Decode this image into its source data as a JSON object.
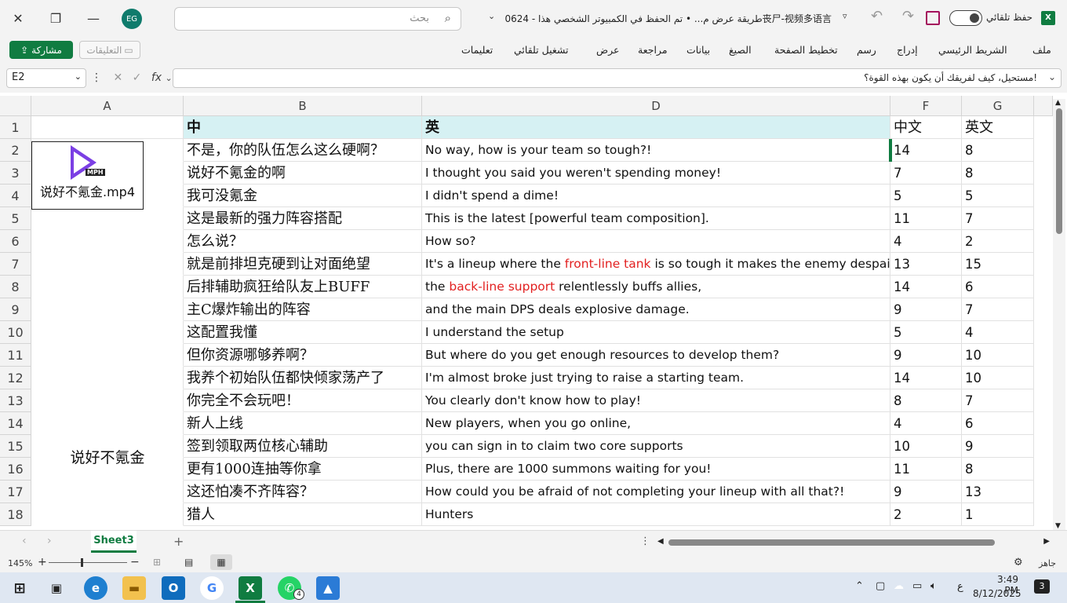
{
  "titlebar": {
    "avatar_initials": "EG",
    "search_placeholder": "بحث",
    "document_title": "طريقة عرض م... • تم الحفظ في الكمبيوتر الشخصي هذا  -  0624丧尸-视频多语言",
    "autosave_label": "حفظ تلقائي"
  },
  "ribbon": {
    "share_label": "مشاركة",
    "comments_label": "التعليقات",
    "tabs": [
      "ملف",
      "الشريط الرئيسي",
      "إدراج",
      "رسم",
      "تخطيط الصفحة",
      "الصيغ",
      "بيانات",
      "مراجعة",
      "عرض",
      "تشغيل تلقائي",
      "تعليمات"
    ]
  },
  "formula_bar": {
    "name_box": "E2",
    "fx_label": "fx",
    "formula": "مستحيل، كيف لفريقك أن يكون بهذه القوة؟!"
  },
  "sheet": {
    "columns": [
      "A",
      "B",
      "D",
      "F",
      "G"
    ],
    "row_numbers": [
      "1",
      "2",
      "3",
      "4",
      "5",
      "6",
      "7",
      "8",
      "9",
      "10",
      "11",
      "12",
      "13",
      "14",
      "15",
      "16",
      "17",
      "18"
    ],
    "header_row": {
      "b": "中",
      "d": "英",
      "f": "中文",
      "g": "英文"
    },
    "rows": [
      {
        "zh": "不是，你的队伍怎么这么硬啊？",
        "en": "No way, how is your team so tough?!",
        "f": "14",
        "g": "8"
      },
      {
        "zh": "说好不氪金的啊",
        "en": "I thought you said you weren't spending money!",
        "f": "7",
        "g": "8"
      },
      {
        "zh": "我可没氪金",
        "en": "I didn't spend a dime!",
        "f": "5",
        "g": "5"
      },
      {
        "zh": "这是最新的强力阵容搭配",
        "en": "This is the latest [powerful team composition].",
        "f": "11",
        "g": "7"
      },
      {
        "zh": "怎么说？",
        "en": "How so?",
        "f": "4",
        "g": "2"
      },
      {
        "zh": "就是前排坦克硬到让对面绝望",
        "en_pre": "It's a lineup where the ",
        "en_hl": "front-line tank",
        "en_post": " is so tough it makes the enemy despair,",
        "f": "13",
        "g": "15"
      },
      {
        "zh": "后排辅助疯狂给队友上BUFF",
        "en_pre": "the ",
        "en_hl": "back-line support",
        "en_post": " relentlessly buffs allies,",
        "f": "14",
        "g": "6"
      },
      {
        "zh": "主C爆炸输出的阵容",
        "en": "and the main DPS deals explosive damage.",
        "f": "9",
        "g": "7"
      },
      {
        "zh": "这配置我懂",
        "en": "I understand the setup",
        "f": "5",
        "g": "4"
      },
      {
        "zh": "但你资源哪够养啊？",
        "en": "But where do you get enough resources to develop them?",
        "f": "9",
        "g": "10"
      },
      {
        "zh": "我养个初始队伍都快倾家荡产了",
        "en": "I'm almost broke just trying to raise a starting team.",
        "f": "14",
        "g": "10"
      },
      {
        "zh": "你完全不会玩吧！",
        "en": "You clearly don't know how to play!",
        "f": "8",
        "g": "7"
      },
      {
        "zh": "新人上线",
        "en": "New players, when you go online,",
        "f": "4",
        "g": "6"
      },
      {
        "zh": "签到领取两位核心辅助",
        "en": "you can sign in to claim two core supports",
        "f": "10",
        "g": "9"
      },
      {
        "zh": "更有1000连抽等你拿",
        "en": "Plus, there are 1000 summons waiting for you!",
        "f": "11",
        "g": "8"
      },
      {
        "zh": "这还怕凑不齐阵容？",
        "en": "How could you be afraid of not completing your lineup with all that?!",
        "f": "9",
        "g": "13"
      },
      {
        "zh": "猎人",
        "en": "Hunters",
        "f": "2",
        "g": "1"
      }
    ],
    "video_object": {
      "badge": "MPH",
      "caption": "说好不氪金.mp4"
    },
    "a_column_label": "说好不氪金"
  },
  "tabs_bar": {
    "sheet_name": "Sheet3",
    "add": "+"
  },
  "status_bar": {
    "zoom": "145%",
    "ready": "جاهز"
  },
  "taskbar": {
    "time": "3:49 PM",
    "date": "8/12/2025",
    "lang": "ع",
    "notifications": "3",
    "whatsapp_badge": "4"
  },
  "colors": {
    "accent": "#107c41",
    "header_fill": "#d6f1f3",
    "highlight_text": "#e21f1f"
  }
}
